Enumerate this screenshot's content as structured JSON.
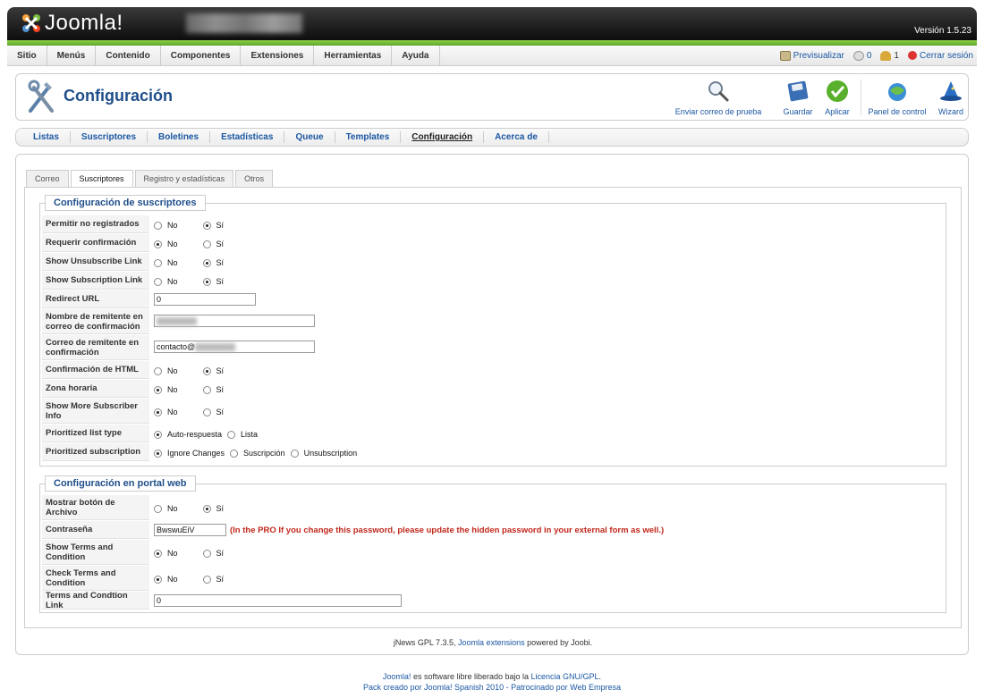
{
  "header": {
    "logo_text": "Joomla!",
    "version": "Versión 1.5.23"
  },
  "menu": {
    "items": [
      "Sitio",
      "Menús",
      "Contenido",
      "Componentes",
      "Extensiones",
      "Herramientas",
      "Ayuda"
    ],
    "preview": "Previsualizar",
    "messages_count": "0",
    "users_count": "1",
    "logout": "Cerrar sesión"
  },
  "toolbar": {
    "title": "Configuración",
    "send_test": "Enviar correo de prueba",
    "save": "Guardar",
    "apply": "Aplicar",
    "control_panel": "Panel de control",
    "wizard": "Wizard"
  },
  "subnav": [
    "Listas",
    "Suscriptores",
    "Boletines",
    "Estadísticas",
    "Queue",
    "Templates",
    "Configuración",
    "Acerca de"
  ],
  "tabs": [
    "Correo",
    "Suscriptores",
    "Registro y estadísticas",
    "Otros"
  ],
  "subscribers_section": {
    "legend": "Configuración de suscriptores",
    "rows": [
      {
        "label": "Permitir no registrados",
        "type": "yesno",
        "value": "Sí"
      },
      {
        "label": "Requerir confirmación",
        "type": "yesno",
        "value": "No"
      },
      {
        "label": "Show Unsubscribe Link",
        "type": "yesno",
        "value": "Sí"
      },
      {
        "label": "Show Subscription Link",
        "type": "yesno",
        "value": "Sí"
      },
      {
        "label": "Redirect URL",
        "type": "text",
        "value": "0"
      },
      {
        "label": "Nombre de remitente en correo de confirmación",
        "type": "text",
        "value": ""
      },
      {
        "label": "Correo de remitente en confirmación",
        "type": "text",
        "value": "contacto@"
      },
      {
        "label": "Confirmación de HTML",
        "type": "yesno",
        "value": "Sí"
      },
      {
        "label": "Zona horaria",
        "type": "yesno",
        "value": "No"
      },
      {
        "label": "Show More Subscriber Info",
        "type": "yesno",
        "value": "No"
      },
      {
        "label": "Prioritized list type",
        "type": "radio",
        "options": [
          "Auto-respuesta",
          "Lista"
        ],
        "value": "Auto-respuesta"
      },
      {
        "label": "Prioritized subscription",
        "type": "radio",
        "options": [
          "Ignore Changes",
          "Suscripción",
          "Unsubscription"
        ],
        "value": "Ignore Changes"
      }
    ]
  },
  "portal_section": {
    "legend": "Configuración en portal web",
    "rows": [
      {
        "label": "Mostrar botón de Archivo",
        "type": "yesno",
        "value": "Sí"
      },
      {
        "label": "Contraseña",
        "type": "text",
        "value": "BwswuEiV",
        "note": "(In the PRO If you change this password, please update the hidden password in your external form as well.)"
      },
      {
        "label": "Show Terms and Condition",
        "type": "yesno",
        "value": "No"
      },
      {
        "label": "Check Terms and Condition",
        "type": "yesno",
        "value": "No"
      },
      {
        "label": "Terms and Condtion Link",
        "type": "text",
        "value": "0"
      }
    ]
  },
  "radio_labels": {
    "no": "No",
    "yes": "Sí"
  },
  "credit": {
    "prefix": "jNews GPL 7.3.5, ",
    "link": "Joomla extensions",
    "suffix": " powered by Joobi."
  },
  "footer": {
    "line1_link1": "Joomla!",
    "line1_text": " es software libre liberado bajo la ",
    "line1_link2": "Licencia GNU/GPL",
    "line1_end": ".",
    "line2": "Pack creado por Joomla! Spanish 2010 - Patrocinado por Web Empresa"
  }
}
